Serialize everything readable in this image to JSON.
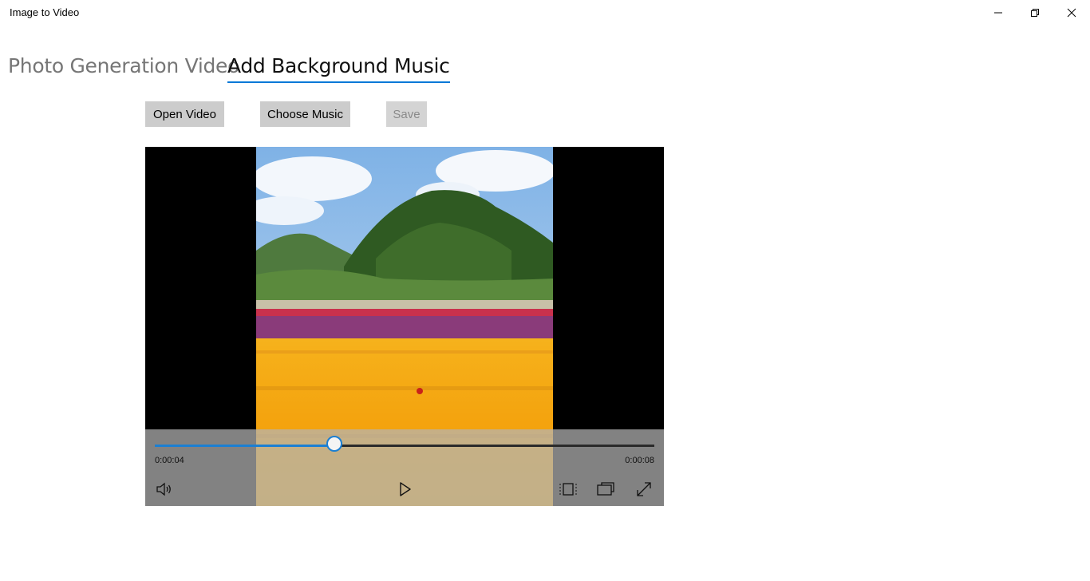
{
  "window": {
    "title": "Image to Video",
    "controls": [
      {
        "name": "minimize-icon"
      },
      {
        "name": "restore-icon"
      },
      {
        "name": "close-icon"
      }
    ]
  },
  "tabs": [
    {
      "label": "Photo Generation Video",
      "selected": false
    },
    {
      "label": "Add Background Music",
      "selected": true
    }
  ],
  "toolbar": {
    "open_video_label": "Open Video",
    "choose_music_label": "Choose Music",
    "save_label": "Save",
    "save_enabled": false
  },
  "player": {
    "current_time": "0:00:04",
    "total_time": "0:00:08",
    "progress": 0.36,
    "icons": {
      "volume": "volume-icon",
      "play": "play-icon",
      "aspect_ratio": "aspect-ratio-icon",
      "cast": "cast-to-device-icon",
      "fullscreen": "fullscreen-icon"
    },
    "accent_color": "#1b7fd3"
  },
  "colors": {
    "tab_underline": "#0078d7",
    "button_bg": "#cccccc",
    "inactive_tab": "#767676"
  }
}
